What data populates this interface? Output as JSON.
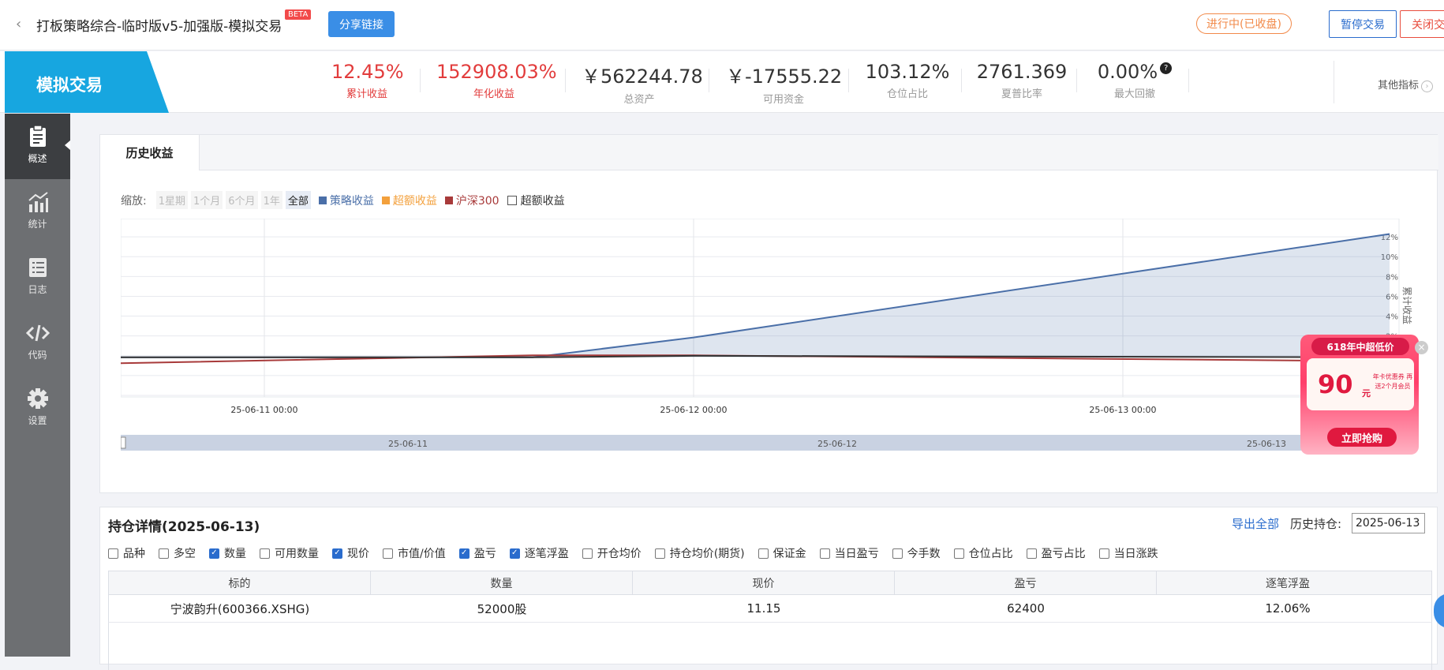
{
  "header": {
    "title": "打板策略综合-临时版v5-加强版-模拟交易",
    "beta": "BETA",
    "share_label": "分享链接",
    "status": "进行中(已收盘)",
    "pause_label": "暂停交易",
    "close_label": "关闭交"
  },
  "metrics": {
    "mode_label": "模拟交易",
    "items": [
      {
        "value": "12.45%",
        "label": "累计收益"
      },
      {
        "value": "152908.03%",
        "label": "年化收益"
      },
      {
        "value": "￥562244.78",
        "label": "总资产"
      },
      {
        "value": "￥-17555.22",
        "label": "可用资金"
      },
      {
        "value": "103.12%",
        "label": "仓位占比"
      },
      {
        "value": "2761.369",
        "label": "夏普比率"
      },
      {
        "value": "0.00%",
        "label": "最大回撤"
      }
    ],
    "other_label": "其他指标",
    "help_glyph": "?"
  },
  "sidebar": {
    "items": [
      {
        "label": "概述",
        "icon": "clipboard-icon"
      },
      {
        "label": "统计",
        "icon": "chart-icon"
      },
      {
        "label": "日志",
        "icon": "list-icon"
      },
      {
        "label": "代码",
        "icon": "code-icon"
      },
      {
        "label": "设置",
        "icon": "gear-icon"
      }
    ]
  },
  "chart_panel": {
    "tab_label": "历史收益",
    "zoom_label": "缩放:",
    "zoom_options": [
      "1星期",
      "1个月",
      "6个月",
      "1年",
      "全部"
    ],
    "legend": [
      {
        "name": "策略收益",
        "color": "#4a6fa8"
      },
      {
        "name": "超额收益",
        "color": "#f3a03c"
      },
      {
        "name": "沪深300",
        "color": "#a83a3a"
      },
      {
        "name": "超额收益",
        "color": "#333333"
      }
    ]
  },
  "chart_data": {
    "type": "line",
    "ylabel": "累计收益",
    "y_ticks": [
      "12%",
      "10%",
      "8%",
      "6%",
      "4%",
      "2%"
    ],
    "ylim": [
      -4,
      14
    ],
    "x_ticks": [
      "25-06-11 00:00",
      "25-06-12 00:00",
      "25-06-13 00:00"
    ],
    "navigator_ticks": [
      "25-06-11",
      "25-06-12",
      "25-06-13"
    ],
    "series": [
      {
        "name": "策略收益",
        "color": "#4a6fa8",
        "x": [
          "25-06-10 15:00",
          "25-06-11 15:00",
          "25-06-12 00:00",
          "25-06-13 15:00"
        ],
        "values": [
          0,
          0,
          2.0,
          12.45
        ]
      },
      {
        "name": "沪深300",
        "color": "#a83a3a",
        "x": [
          "25-06-10 15:00",
          "25-06-11 15:00",
          "25-06-12 00:00",
          "25-06-13 15:00"
        ],
        "values": [
          -0.6,
          0.2,
          0.2,
          -0.4
        ]
      },
      {
        "name": "超额收益",
        "color": "#333333",
        "x": [
          "25-06-10 15:00",
          "25-06-11 15:00",
          "25-06-12 00:00",
          "25-06-13 15:00"
        ],
        "values": [
          0,
          0,
          0.15,
          0
        ]
      }
    ]
  },
  "promo": {
    "top": "618年中超低价",
    "price": "90",
    "unit": "元",
    "note": "年卡优惠券 再送2个月会员",
    "button": "立即抢购",
    "close_glyph": "×"
  },
  "holdings": {
    "title": "持仓详情(2025-06-13)",
    "export_label": "导出全部",
    "history_label": "历史持仓:",
    "date_value": "2025-06-13",
    "options": [
      {
        "label": "品种",
        "checked": false
      },
      {
        "label": "多空",
        "checked": false
      },
      {
        "label": "数量",
        "checked": true
      },
      {
        "label": "可用数量",
        "checked": false
      },
      {
        "label": "现价",
        "checked": true
      },
      {
        "label": "市值/价值",
        "checked": false
      },
      {
        "label": "盈亏",
        "checked": true
      },
      {
        "label": "逐笔浮盈",
        "checked": true
      },
      {
        "label": "开仓均价",
        "checked": false
      },
      {
        "label": "持仓均价(期货)",
        "checked": false
      },
      {
        "label": "保证金",
        "checked": false
      },
      {
        "label": "当日盈亏",
        "checked": false
      },
      {
        "label": "今手数",
        "checked": false
      },
      {
        "label": "仓位占比",
        "checked": false
      },
      {
        "label": "盈亏占比",
        "checked": false
      },
      {
        "label": "当日涨跌",
        "checked": false
      }
    ],
    "columns": [
      "标的",
      "数量",
      "现价",
      "盈亏",
      "逐笔浮盈"
    ],
    "rows": [
      [
        "宁波韵升(600366.XSHG)",
        "52000股",
        "11.15",
        "62400",
        "12.06%"
      ]
    ]
  }
}
